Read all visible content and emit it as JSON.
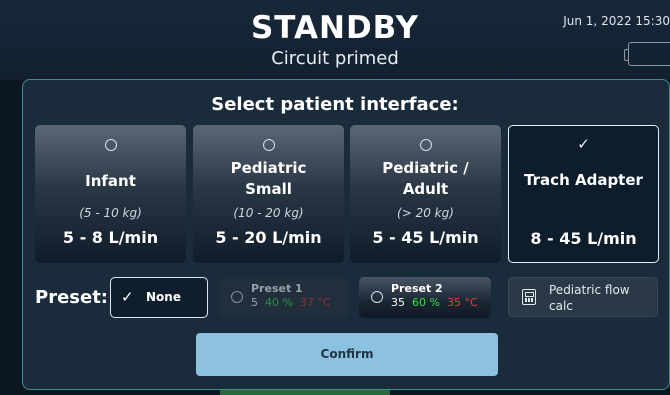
{
  "header": {
    "status_title": "STANDBY",
    "status_subtitle": "Circuit primed",
    "datetime": "Jun 1, 2022 15:30"
  },
  "modal": {
    "title": "Select patient interface:",
    "cards": [
      {
        "name_line1": "Infant",
        "name_line2": "",
        "range": "(5 - 10 kg)",
        "flow": "5 - 8 L/min",
        "selected": false
      },
      {
        "name_line1": "Pediatric",
        "name_line2": "Small",
        "range": "(10 - 20 kg)",
        "flow": "5 - 20 L/min",
        "selected": false
      },
      {
        "name_line1": "Pediatric /",
        "name_line2": "Adult",
        "range": "(> 20 kg)",
        "flow": "5 - 45 L/min",
        "selected": false
      },
      {
        "name_line1": "Trach Adapter",
        "name_line2": "",
        "range": "",
        "flow": "8 - 45 L/min",
        "selected": true
      }
    ],
    "preset_label": "Preset:",
    "presets": {
      "none": {
        "label": "None",
        "selected": true
      },
      "preset1": {
        "name": "Preset 1",
        "flow": "5",
        "o2": "40 %",
        "temp": "37 °C",
        "enabled": false
      },
      "preset2": {
        "name": "Preset 2",
        "flow": "35",
        "o2": "60 %",
        "temp": "35 °C",
        "enabled": true
      }
    },
    "calc_button": "Pediatric flow calc",
    "confirm_button": "Confirm"
  },
  "colors": {
    "accent_border": "#3f8f90",
    "confirm_bg": "#8cc1e0",
    "o2_green": "#3fdc4a",
    "temp_red": "#f03a3a"
  },
  "icons": {
    "radio": "radio-unchecked-icon",
    "selected": "check-circle-icon",
    "calculator": "calculator-icon",
    "battery": "battery-icon"
  }
}
